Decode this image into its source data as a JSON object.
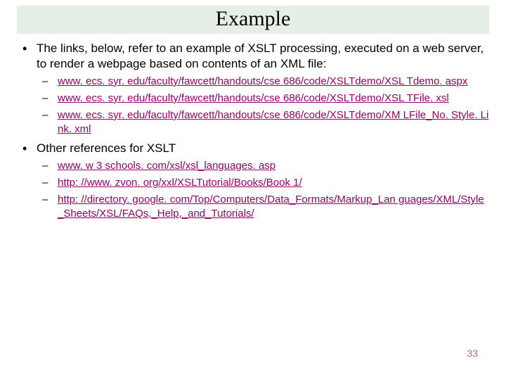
{
  "title": "Example",
  "bullets": [
    {
      "text": "The links, below, refer to an example of XSLT processing, executed on a web server, to render a webpage based on contents of an XML file:",
      "sub": [
        "www. ecs. syr. edu/faculty/fawcett/handouts/cse 686/code/XSLTdemo/XSL Tdemo. aspx",
        "www. ecs. syr. edu/faculty/fawcett/handouts/cse 686/code/XSLTdemo/XSL TFile. xsl",
        "www. ecs. syr. edu/faculty/fawcett/handouts/cse 686/code/XSLTdemo/XM LFile_No. Style. Link. xml"
      ]
    },
    {
      "text": "Other references for XSLT",
      "sub": [
        "www. w 3 schools. com/xsl/xsl_languages. asp",
        "http: //www. zvon. org/xxl/XSLTutorial/Books/Book 1/",
        "http: //directory. google. com/Top/Computers/Data_Formats/Markup_Lan guages/XML/Style_Sheets/XSL/FAQs,_Help,_and_Tutorials/"
      ]
    }
  ],
  "page_number": "33"
}
